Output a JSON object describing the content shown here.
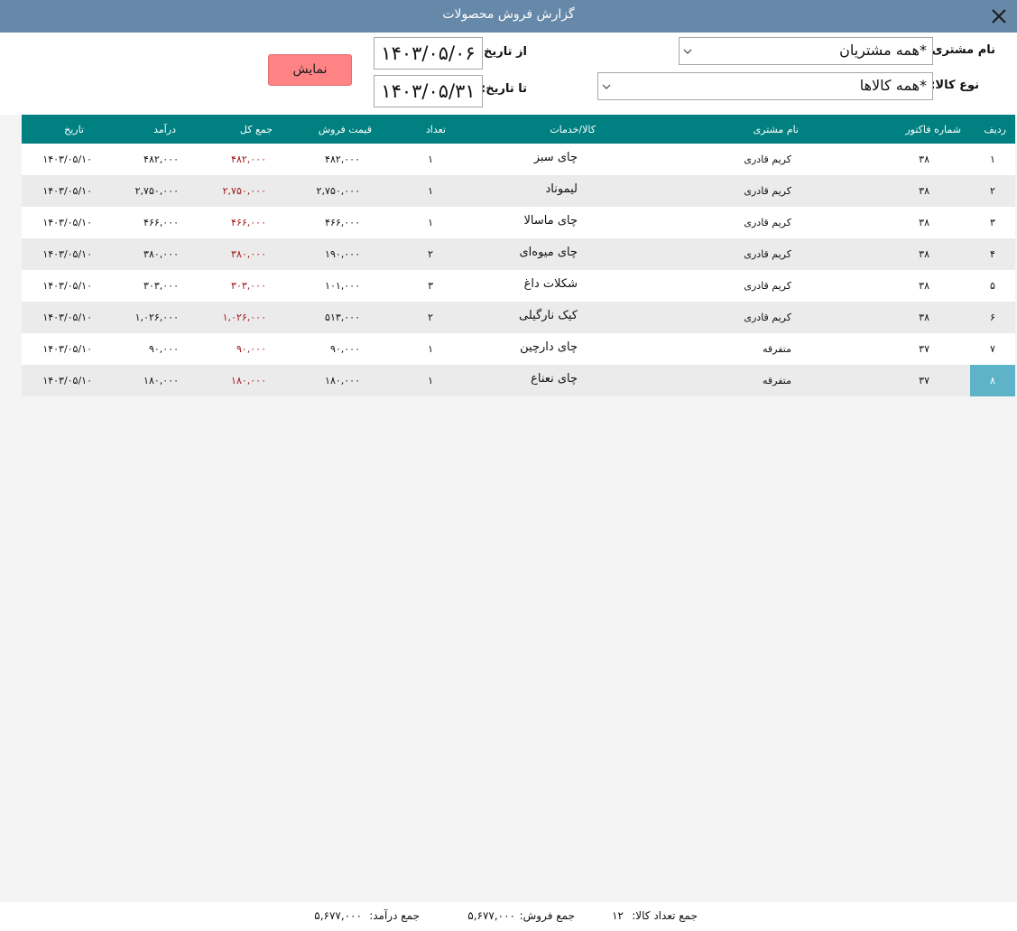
{
  "window": {
    "title": "گزارش فروش محصولات",
    "accent_color": "#6688a9",
    "close_icon": "close-icon"
  },
  "filters": {
    "customer_label": "نام مشتری:",
    "customer_value": "*همه مشتریان",
    "product_type_label": "نوع کالا:",
    "product_type_value": "*همه کالاها",
    "from_date_label": "از تاریخ:",
    "from_date_value": "۱۴۰۳/۰۵/۰۶",
    "to_date_label": "تا تاریخ:",
    "to_date_value": "۱۴۰۳/۰۵/۳۱",
    "show_button_label": "نمایش",
    "show_button_color": "#ff8385"
  },
  "table": {
    "header_color": "#008080",
    "total_text_color": "#a01a1a",
    "selected_row_color": "#5fb3c9",
    "columns": {
      "row": "ردیف",
      "invoice": "شماره فاکتور",
      "customer": "نام مشتری",
      "product": "کالا/خدمات",
      "qty": "تعداد",
      "price": "قیمت فروش",
      "total": "جمع کل",
      "income": "درآمد",
      "date": "تاریخ"
    },
    "rows": [
      {
        "row": "۱",
        "invoice": "۳۸",
        "customer": "کریم قادری",
        "product": "چای سبز",
        "qty": "۱",
        "price": "۴۸۲,۰۰۰",
        "total": "۴۸۲,۰۰۰",
        "income": "۴۸۲,۰۰۰",
        "date": "۱۴۰۳/۰۵/۱۰"
      },
      {
        "row": "۲",
        "invoice": "۳۸",
        "customer": "کریم قادری",
        "product": "لیموناد",
        "qty": "۱",
        "price": "۲,۷۵۰,۰۰۰",
        "total": "۲,۷۵۰,۰۰۰",
        "income": "۲,۷۵۰,۰۰۰",
        "date": "۱۴۰۳/۰۵/۱۰"
      },
      {
        "row": "۳",
        "invoice": "۳۸",
        "customer": "کریم قادری",
        "product": "چای ماسالا",
        "qty": "۱",
        "price": "۴۶۶,۰۰۰",
        "total": "۴۶۶,۰۰۰",
        "income": "۴۶۶,۰۰۰",
        "date": "۱۴۰۳/۰۵/۱۰"
      },
      {
        "row": "۴",
        "invoice": "۳۸",
        "customer": "کریم قادری",
        "product": "چای میوه‌ای",
        "qty": "۲",
        "price": "۱۹۰,۰۰۰",
        "total": "۳۸۰,۰۰۰",
        "income": "۳۸۰,۰۰۰",
        "date": "۱۴۰۳/۰۵/۱۰"
      },
      {
        "row": "۵",
        "invoice": "۳۸",
        "customer": "کریم قادری",
        "product": "شکلات داغ",
        "qty": "۳",
        "price": "۱۰۱,۰۰۰",
        "total": "۳۰۳,۰۰۰",
        "income": "۳۰۳,۰۰۰",
        "date": "۱۴۰۳/۰۵/۱۰"
      },
      {
        "row": "۶",
        "invoice": "۳۸",
        "customer": "کریم قادری",
        "product": "کیک نارگیلی",
        "qty": "۲",
        "price": "۵۱۳,۰۰۰",
        "total": "۱,۰۲۶,۰۰۰",
        "income": "۱,۰۲۶,۰۰۰",
        "date": "۱۴۰۳/۰۵/۱۰"
      },
      {
        "row": "۷",
        "invoice": "۳۷",
        "customer": "متفرقه",
        "product": "چای دارچین",
        "qty": "۱",
        "price": "۹۰,۰۰۰",
        "total": "۹۰,۰۰۰",
        "income": "۹۰,۰۰۰",
        "date": "۱۴۰۳/۰۵/۱۰"
      },
      {
        "row": "۸",
        "invoice": "۳۷",
        "customer": "متفرقه",
        "product": "چای نعناع",
        "qty": "۱",
        "price": "۱۸۰,۰۰۰",
        "total": "۱۸۰,۰۰۰",
        "income": "۱۸۰,۰۰۰",
        "date": "۱۴۰۳/۰۵/۱۰",
        "selected": true
      }
    ]
  },
  "footer": {
    "total_qty_label": "جمع تعداد کالا:",
    "total_qty_value": "۱۲",
    "total_sales_label": "جمع فروش:",
    "total_sales_value": "۵,۶۷۷,۰۰۰",
    "total_income_label": "جمع درآمد:",
    "total_income_value": "۵,۶۷۷,۰۰۰"
  }
}
